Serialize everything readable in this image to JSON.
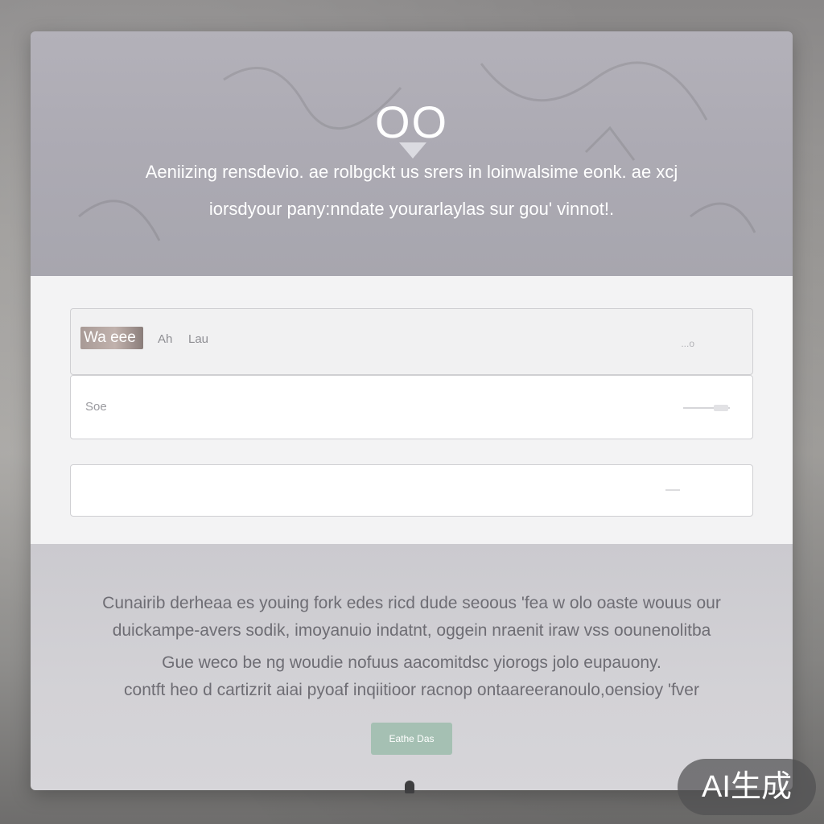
{
  "hero": {
    "logo_text": "OO",
    "description_line1": "Aeniizing rensdevio. ae rolbgckt us srers in loinwalsime eonk. ae xcj",
    "description_line2": "iorsdyour pany:nndate yourarlaylas sur gou' vinnot!."
  },
  "form": {
    "field1": {
      "thumbnail_text": "Wa eee",
      "text1": "Ah",
      "text2": "Lau",
      "right_text": "...o"
    },
    "field2": {
      "label": "Soe"
    },
    "field3": {}
  },
  "footer": {
    "paragraph1_line1": "Cunairib derheaa es youing  fork edes ricd dude seoous  'fea  w olo oaste wouus our",
    "paragraph1_line2": "duickampe-avers sodik, imoyanuio indatnt, oggein nraenit iraw vss oounenolitba",
    "paragraph2_line1": "Gue weco be ng woudie nofuus  aacomitdsc yiorogs jolo eupauony.",
    "paragraph2_line2": "contft heo d cartizrit aiai pyoaf inqiitioor racnop ontaareeranoulo,oensioy 'fver",
    "cta_label": "Eathe Das"
  },
  "watermark": {
    "text": "AI生成"
  },
  "colors": {
    "hero_bg": "#b0aeb6",
    "form_bg": "#f3f3f4",
    "footer_bg": "#d0cfd3",
    "cta_bg": "#a5c0b3",
    "text_white": "#ffffff",
    "text_muted": "#6e6d74"
  }
}
